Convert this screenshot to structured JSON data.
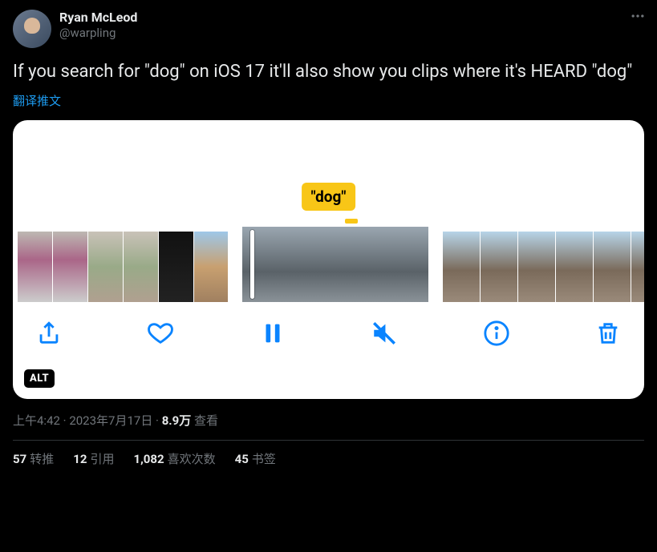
{
  "author": {
    "display_name": "Ryan McLeod",
    "handle": "@warpling"
  },
  "tweet_text": "If you search for \"dog\" on iOS 17 it'll also show you clips where it's HEARD \"dog\"",
  "translate_label": "翻译推文",
  "media": {
    "search_token": "\"dog\"",
    "alt_badge": "ALT"
  },
  "meta": {
    "time": "上午4:42",
    "dot1": " · ",
    "date": "2023年7月17日",
    "dot2": " · ",
    "views_count": "8.9万",
    "views_label": " 查看"
  },
  "stats": {
    "retweets_count": "57",
    "retweets_label": "转推",
    "quotes_count": "12",
    "quotes_label": "引用",
    "likes_count": "1,082",
    "likes_label": "喜欢次数",
    "bookmarks_count": "45",
    "bookmarks_label": "书签"
  }
}
